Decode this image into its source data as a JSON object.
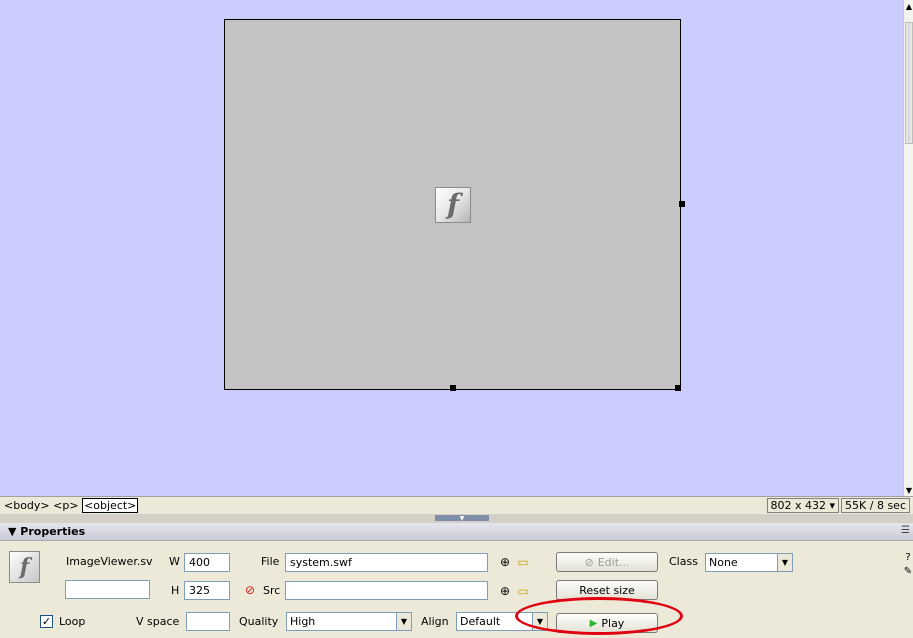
{
  "canvas": {
    "background": "#ccccff",
    "swf_placeholder": {
      "icon": "flash-icon"
    }
  },
  "status_bar": {
    "tags": [
      "<body>",
      "<p>",
      "<object>"
    ],
    "window_size": "802 x 432",
    "window_size_arrow": "▾",
    "download_info": "55K / 8 sec"
  },
  "properties": {
    "title": "▼ Properties",
    "name_label": "ImageViewer.sv",
    "name_value": "",
    "w_label": "W",
    "w_value": "400",
    "h_label": "H",
    "h_value": "325",
    "file_label": "File",
    "file_value": "system.swf",
    "src_label": "Src",
    "src_value": "",
    "edit_button": "Edit...",
    "reset_size_button": "Reset size",
    "class_label": "Class",
    "class_value": "None",
    "loop_label": "Loop",
    "loop_checked": true,
    "vspace_label": "V space",
    "vspace_value": "",
    "quality_label": "Quality",
    "quality_value": "High",
    "align_label": "Align",
    "align_value": "Default",
    "play_button": "Play"
  },
  "colors": {
    "highlight": "#e00010",
    "play_icon": "#2bb52b"
  }
}
